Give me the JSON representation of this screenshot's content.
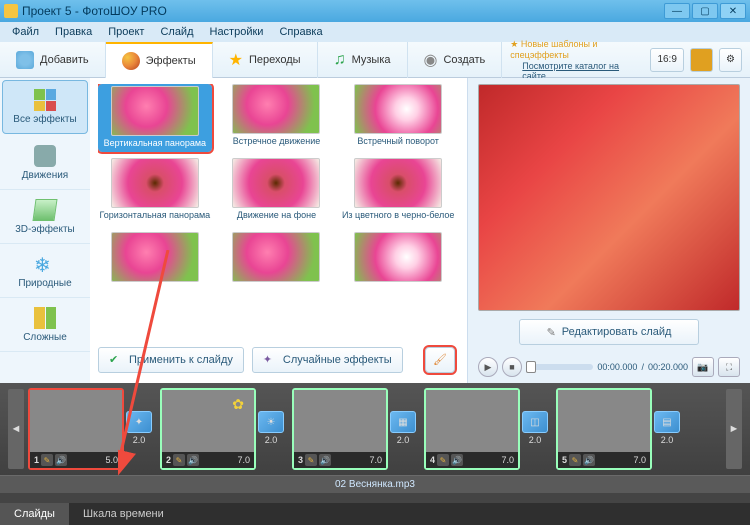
{
  "window": {
    "title": "Проект 5 - ФотоШОУ PRO"
  },
  "menu": {
    "items": [
      "Файл",
      "Правка",
      "Проект",
      "Слайд",
      "Настройки",
      "Справка"
    ]
  },
  "tabs": {
    "add": "Добавить",
    "effects": "Эффекты",
    "transitions": "Переходы",
    "music": "Музыка",
    "create": "Создать"
  },
  "categories": {
    "all": "Все эффекты",
    "move": "Движения",
    "three_d": "3D-эффекты",
    "nature": "Природные",
    "complex": "Сложные"
  },
  "effects": [
    "Вертикальная панорама",
    "Встречное движение",
    "Встречный поворот",
    "Горизонтальная панорама",
    "Движение на фоне",
    "Из цветного в черно-белое"
  ],
  "fx_buttons": {
    "apply": "Применить к слайду",
    "random": "Случайные эффекты"
  },
  "promo": {
    "line1": "Новые шаблоны и спецэффекты",
    "link": "Посмотрите каталог на сайте..."
  },
  "aspect": "16:9",
  "edit_slide": "Редактировать слайд",
  "time": {
    "current": "00:00.000",
    "total": "00:20.000"
  },
  "slides": [
    {
      "num": "1",
      "dur": "5.0",
      "trans": "2.0"
    },
    {
      "num": "2",
      "dur": "7.0",
      "trans": "2.0"
    },
    {
      "num": "3",
      "dur": "7.0",
      "trans": "2.0"
    },
    {
      "num": "4",
      "dur": "7.0",
      "trans": "2.0"
    },
    {
      "num": "5",
      "dur": "7.0",
      "trans": "2.0"
    }
  ],
  "audio": "02 Веснянка.mp3",
  "bottom_tabs": {
    "slides": "Слайды",
    "timescale": "Шкала времени"
  }
}
